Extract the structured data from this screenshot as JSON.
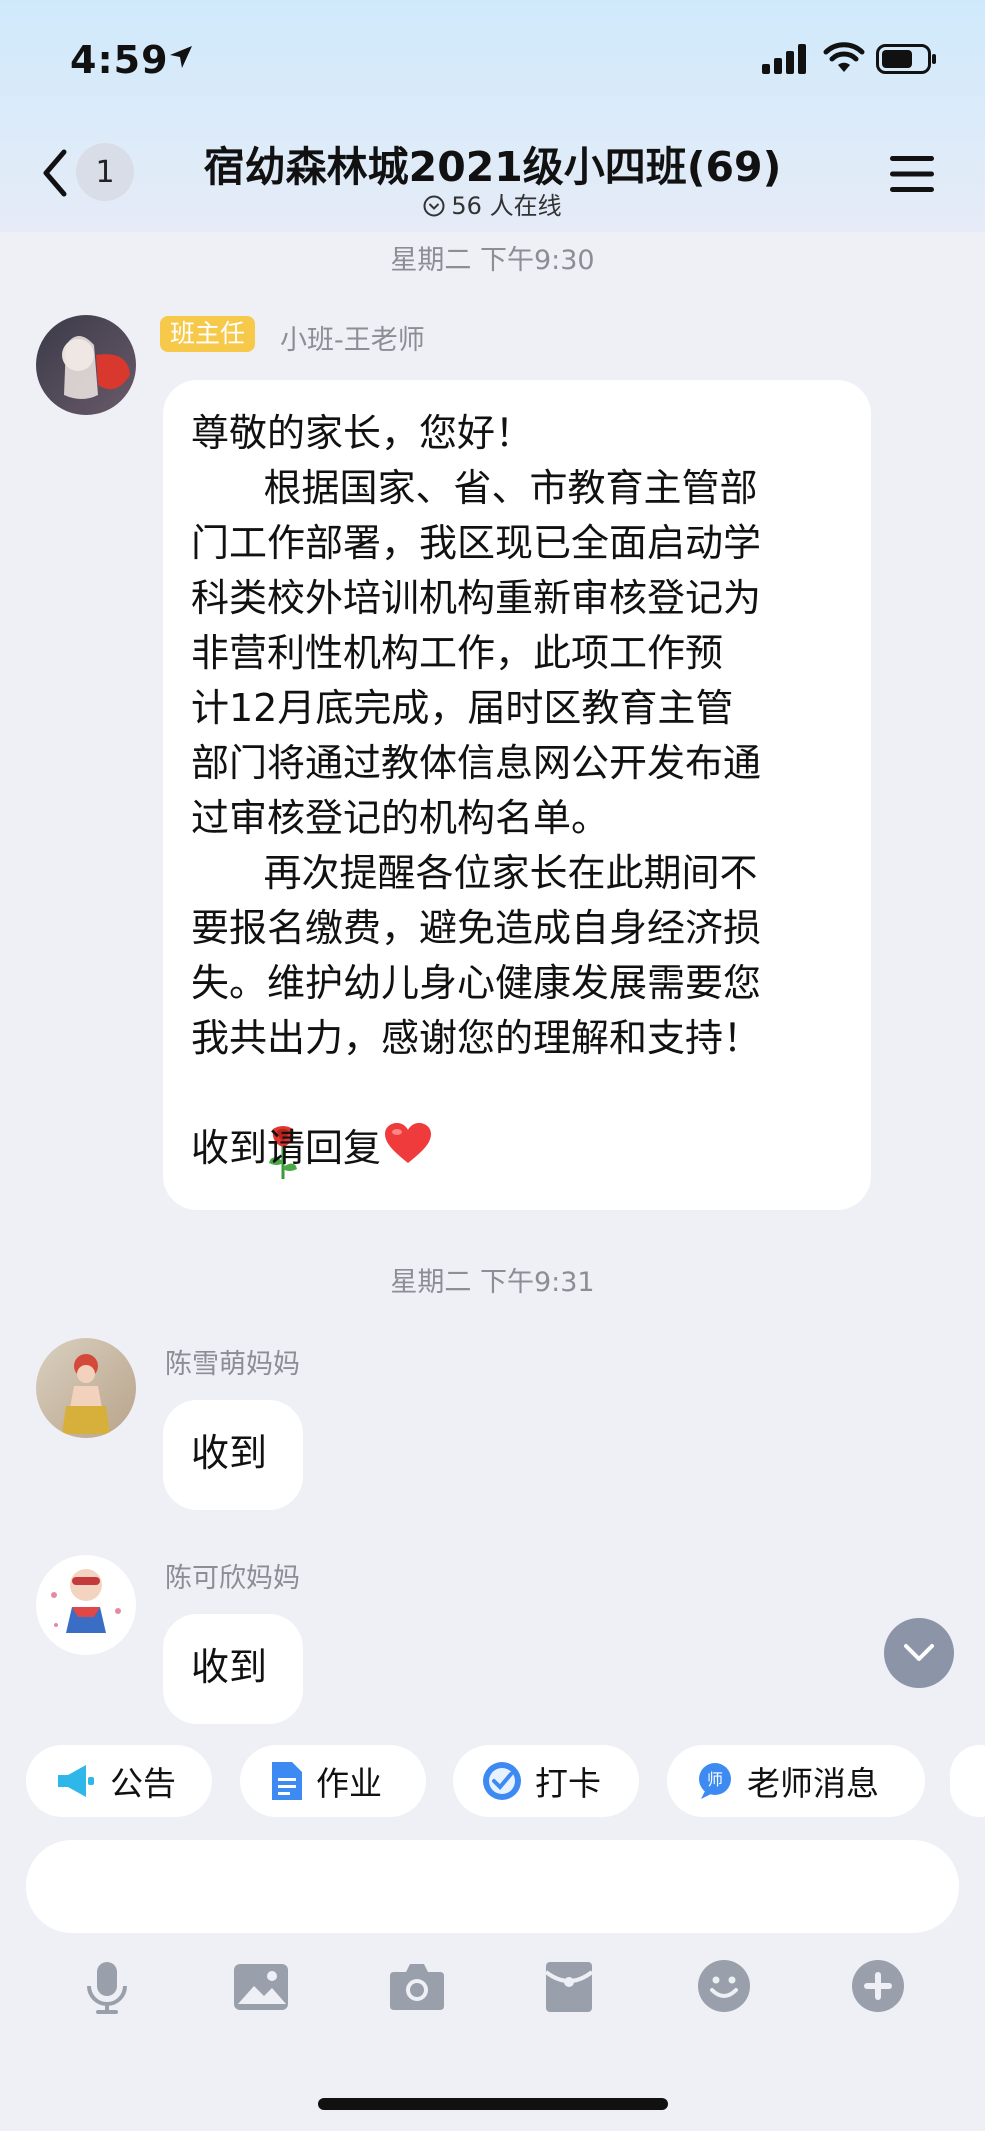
{
  "status_bar": {
    "time": "4:59"
  },
  "header": {
    "back_count": "1",
    "title": "宿幼森林城2021级小四班(69)",
    "online": "56 人在线"
  },
  "messages": [
    {
      "timestamp": "星期二 下午9:30",
      "role_badge": "班主任",
      "sender": "小班-王老师",
      "lines": [
        "尊敬的家长，您好！",
        "      根据国家、省、市教育主管部",
        "门工作部署，我区现已全面启动学",
        "科类校外培训机构重新审核登记为",
        "非营利性机构工作，此项工作预",
        "计12月底完成，届时区教育主管",
        "部门将通过教体信息网公开发布通",
        "过审核登记的机构名单。",
        "      再次提醒各位家长在此期间不",
        "要报名缴费，避免造成自身经济损",
        "失。维护幼儿身心健康发展需要您",
        "我共出力，感谢您的理解和支持！",
        "",
        "收到请回复"
      ]
    },
    {
      "timestamp": "星期二 下午9:31",
      "sender": "陈雪萌妈妈",
      "text": "收到"
    },
    {
      "sender": "陈可欣妈妈",
      "text": "收到"
    }
  ],
  "quick_actions": [
    {
      "label": "公告",
      "icon": "megaphone-icon"
    },
    {
      "label": "作业",
      "icon": "document-icon"
    },
    {
      "label": "打卡",
      "icon": "checkin-icon"
    },
    {
      "label": "老师消息",
      "icon": "teacher-icon"
    }
  ],
  "toolbar_icons": [
    "microphone-icon",
    "image-icon",
    "camera-icon",
    "red-packet-icon",
    "emoji-icon",
    "plus-icon"
  ],
  "colors": {
    "role_badge": "#f6c94a",
    "accent_blue": "#3d8bf2",
    "heart": "#ef3b3b"
  }
}
